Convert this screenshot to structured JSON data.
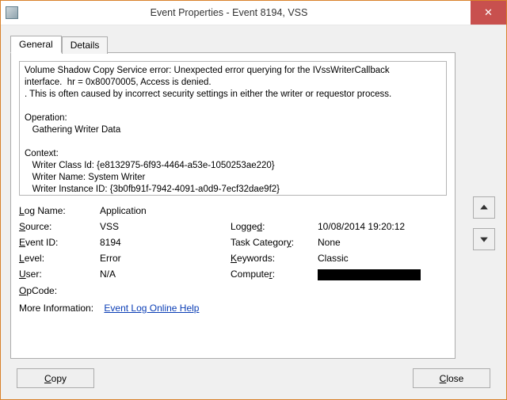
{
  "titlebar": {
    "title": "Event Properties - Event 8194, VSS"
  },
  "tabs": {
    "general": "General",
    "details": "Details"
  },
  "event_text": "Volume Shadow Copy Service error: Unexpected error querying for the IVssWriterCallback\ninterface.  hr = 0x80070005, Access is denied.\n. This is often caused by incorrect security settings in either the writer or requestor process.\n\nOperation:\n   Gathering Writer Data\n\nContext:\n   Writer Class Id: {e8132975-6f93-4464-a53e-1050253ae220}\n   Writer Name: System Writer\n   Writer Instance ID: {3b0fb91f-7942-4091-a0d9-7ecf32dae9f2}",
  "props": {
    "log_name_lbl": "og Name:",
    "log_name": "Application",
    "source_lbl": "ource:",
    "source": "VSS",
    "logged_lbl": "Logge",
    "logged_suffix": ":",
    "logged": "10/08/2014 19:20:12",
    "event_id_lbl": "vent ID:",
    "event_id": "8194",
    "task_cat_lbl_pre": "Task Categor",
    "task_cat_lbl_suf": ":",
    "task_cat": "None",
    "level_lbl": "evel:",
    "level": "Error",
    "keywords_lbl": "eywords:",
    "keywords": "Classic",
    "user_lbl": "ser:",
    "user": "N/A",
    "computer_lbl": "Compute",
    "computer_suffix": ":",
    "opcode_lbl": "pCode:",
    "opcode": "",
    "moreinfo_lbl": "More Information:",
    "moreinfo_link": "Event Log Online Help"
  },
  "buttons": {
    "copy": "opy",
    "close": "lose"
  }
}
